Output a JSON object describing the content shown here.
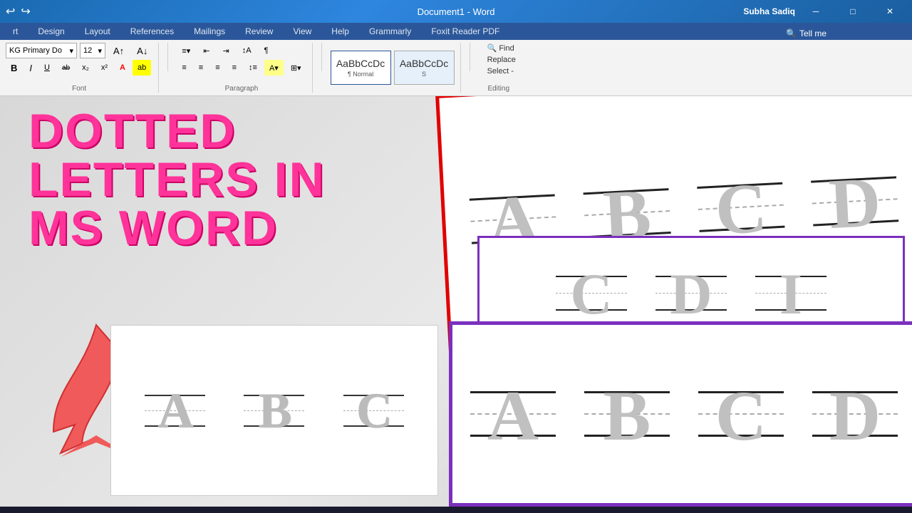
{
  "titlebar": {
    "title": "Document1 - Word",
    "user": "Subha Sadiq",
    "undo_icon": "↩",
    "redo_icon": "↪"
  },
  "menubar": {
    "items": [
      "rt",
      "Design",
      "Layout",
      "References",
      "Mailings",
      "Review",
      "View",
      "Help",
      "Grammarly",
      "Foxit Reader PDF"
    ]
  },
  "ribbon": {
    "font_name": "KG Primary Do",
    "font_size": "12",
    "bold": "B",
    "italic": "I",
    "underline": "U",
    "strikethrough": "ab",
    "styles": [
      {
        "preview": "AaBbCcDc",
        "name": "¶ Normal"
      },
      {
        "preview": "AaBbCcDc",
        "name": "S"
      }
    ],
    "normal_label": "Normal",
    "find_label": "🔍 Find",
    "replace_label": "Replace",
    "select_label": "Select -"
  },
  "overlay": {
    "line1": "DOTTED",
    "line2": "LETTERS IN",
    "line3": "MS WORD"
  },
  "left_letters": [
    "A",
    "B",
    "C"
  ],
  "right_top_letters": [
    "A",
    "B",
    "C",
    "D"
  ],
  "right_mid_letters": [
    "C",
    "D",
    "I"
  ],
  "right_bot_letters": [
    "A",
    "B",
    "C",
    "D"
  ]
}
